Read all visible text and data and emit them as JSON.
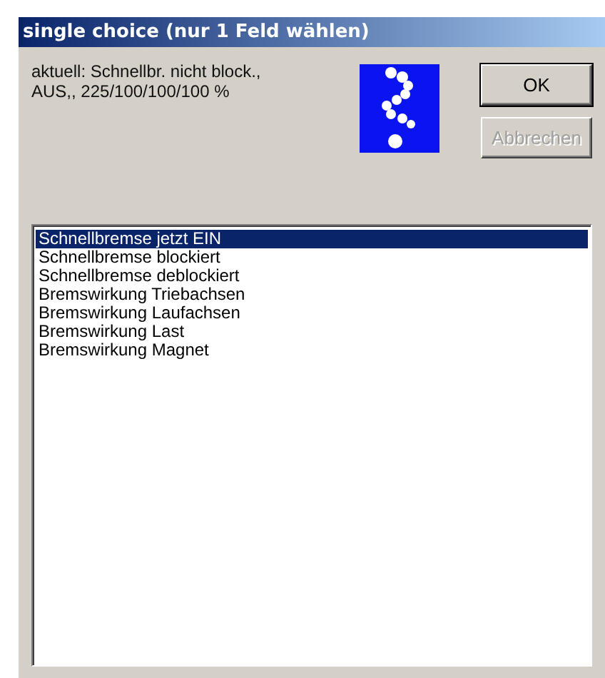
{
  "window": {
    "title": "single choice (nur 1 Feld wählen)"
  },
  "status_text": [
    "aktuell: Schnellbr. nicht block.,",
    "AUS,, 225/100/100/100 %"
  ],
  "buttons": [
    {
      "label": "OK",
      "disabled": false,
      "default": true
    },
    {
      "label": "Abbrechen",
      "disabled": true,
      "default": false
    }
  ],
  "list": {
    "items": [
      {
        "label": "Schnellbremse jetzt EIN",
        "selected": true
      },
      {
        "label": "Schnellbremse blockiert",
        "selected": false
      },
      {
        "label": "Schnellbremse deblockiert",
        "selected": false
      },
      {
        "label": "Bremswirkung Triebachsen",
        "selected": false
      },
      {
        "label": "Bremswirkung Laufachsen",
        "selected": false
      },
      {
        "label": "Bremswirkung Last",
        "selected": false
      },
      {
        "label": "Bremswirkung Magnet",
        "selected": false
      }
    ]
  }
}
